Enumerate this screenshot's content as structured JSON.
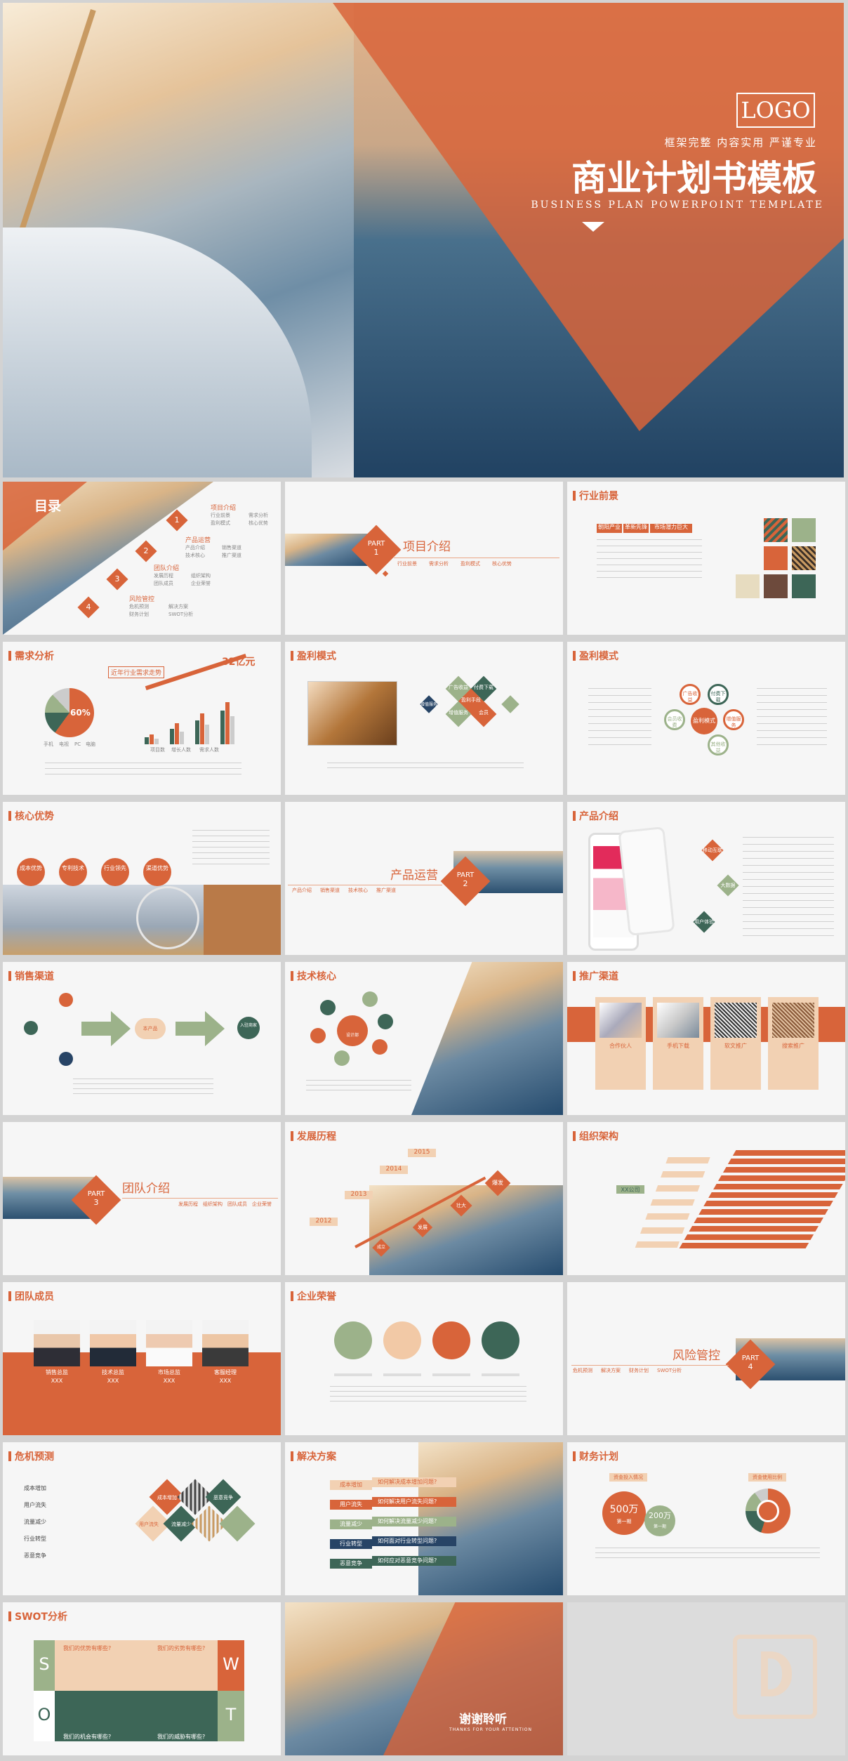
{
  "hero": {
    "logo": "LOGO",
    "tagline": "框架完整  内容实用  严谨专业",
    "title": "商业计划书模板",
    "subtitle": "BUSINESS PLAN POWERPOINT TEMPLATE"
  },
  "toc": {
    "title": "目录",
    "items": [
      {
        "num": "1",
        "label": "项目介绍",
        "subs": [
          "行业前景",
          "需求分析",
          "盈利模式",
          "核心优势"
        ]
      },
      {
        "num": "2",
        "label": "产品运营",
        "subs": [
          "产品介绍",
          "销售渠道",
          "技术核心",
          "推广渠道"
        ]
      },
      {
        "num": "3",
        "label": "团队介绍",
        "subs": [
          "发展历程",
          "组织架构",
          "团队成员",
          "企业荣誉"
        ]
      },
      {
        "num": "4",
        "label": "风险管控",
        "subs": [
          "危机预测",
          "解决方案",
          "财务计划",
          "SWOT分析"
        ]
      }
    ]
  },
  "part1": {
    "part": "PART",
    "num": "1",
    "title": "项目介绍",
    "subs": [
      "行业前景",
      "需求分析",
      "盈利模式",
      "核心优势"
    ]
  },
  "industry": {
    "title": "行业前景",
    "tags": [
      "朝阳产业",
      "革新先锋",
      "市场潜力巨大"
    ]
  },
  "demand": {
    "title": "需求分析",
    "pie_label": "60%",
    "growth_label": "近年行业需求走势",
    "big_value": "32亿元",
    "legend": [
      "手机",
      "电视",
      "PC",
      "电脑"
    ],
    "bar_legend": [
      "项目数",
      "增长人数",
      "需求人数"
    ]
  },
  "profit1": {
    "title": "盈利模式",
    "cells": [
      "广告收益",
      "付费下载",
      "盈利手段",
      "增值服务",
      "会员"
    ],
    "navy": "增值服务"
  },
  "profit2": {
    "title": "盈利模式",
    "cells": [
      "广告收益",
      "付费下载",
      "盈利模式",
      "会员收费",
      "增值服务",
      "其他收益"
    ]
  },
  "core": {
    "title": "核心优势",
    "circles": [
      "成本优势",
      "专利技术",
      "行业领先",
      "渠道优势"
    ]
  },
  "part2": {
    "part": "PART",
    "num": "2",
    "title": "产品运营",
    "subs": [
      "产品介绍",
      "销售渠道",
      "技术核心",
      "推广渠道"
    ]
  },
  "product": {
    "title": "产品介绍",
    "badges": [
      "移动互联",
      "大数据",
      "用户体验"
    ]
  },
  "sales": {
    "title": "销售渠道",
    "center": "本产品",
    "right": "入驻商家"
  },
  "tech": {
    "title": "技术核心",
    "center": "设计部"
  },
  "promo": {
    "title": "推广渠道",
    "cards": [
      "合作伙人",
      "手机下载",
      "软文推广",
      "搜索推广"
    ]
  },
  "part3": {
    "part": "PART",
    "num": "3",
    "title": "团队介绍",
    "subs": [
      "发展历程",
      "组织架构",
      "团队成员",
      "企业荣誉"
    ]
  },
  "history": {
    "title": "发展历程",
    "years": [
      "2015",
      "2014",
      "2013",
      "2012"
    ],
    "stages": [
      "爆发",
      "壮大",
      "发展",
      "成立"
    ]
  },
  "org": {
    "title": "组织架构",
    "root": "XX公司"
  },
  "team": {
    "title": "团队成员",
    "roles": [
      "销售总监",
      "技术总监",
      "市场总监",
      "客服经理"
    ],
    "name": "XXX"
  },
  "honor": {
    "title": "企业荣誉"
  },
  "part4": {
    "part": "PART",
    "num": "4",
    "title": "风险管控",
    "subs": [
      "危机预测",
      "解决方案",
      "财务计划",
      "SWOT分析"
    ]
  },
  "crisis": {
    "title": "危机预测",
    "items": [
      "成本增加",
      "用户流失",
      "流量减少",
      "行业转型",
      "恶意竞争"
    ],
    "diamonds": [
      "成本增加",
      "用户流失",
      "流量减少",
      "恶意竞争"
    ]
  },
  "solution": {
    "title": "解决方案",
    "rows": [
      {
        "tag": "成本增加",
        "q": "如何解决成本增加问题?"
      },
      {
        "tag": "用户流失",
        "q": "如何解决用户流失问题?"
      },
      {
        "tag": "流量减少",
        "q": "如何解决流量减少问题?"
      },
      {
        "tag": "行业转型",
        "q": "如何面对行业转型问题?"
      },
      {
        "tag": "恶意竞争",
        "q": "如何应对恶意竞争问题?"
      }
    ]
  },
  "finance": {
    "title": "财务计划",
    "left_tag": "资金投入情况",
    "v1": "500万",
    "v1_sub": "第一期",
    "v2": "200万",
    "v2_sub": "第一期",
    "right_tag": "资金使用比例"
  },
  "swot": {
    "title": "SWOT分析",
    "q": [
      "我们的优势有哪些?",
      "我们的劣势有哪些?",
      "我们的机会有哪些?",
      "我们的威胁有哪些?"
    ],
    "letters": [
      "S",
      "W",
      "O",
      "T"
    ]
  },
  "thanks": {
    "title": "谢谢聆听",
    "sub": "THANKS FOR YOUR ATTENTION"
  },
  "colors": {
    "accent": "#d8643a",
    "green": "#9cb28a",
    "teal": "#3d6657",
    "navy": "#274466",
    "tan": "#f2d1b3"
  }
}
